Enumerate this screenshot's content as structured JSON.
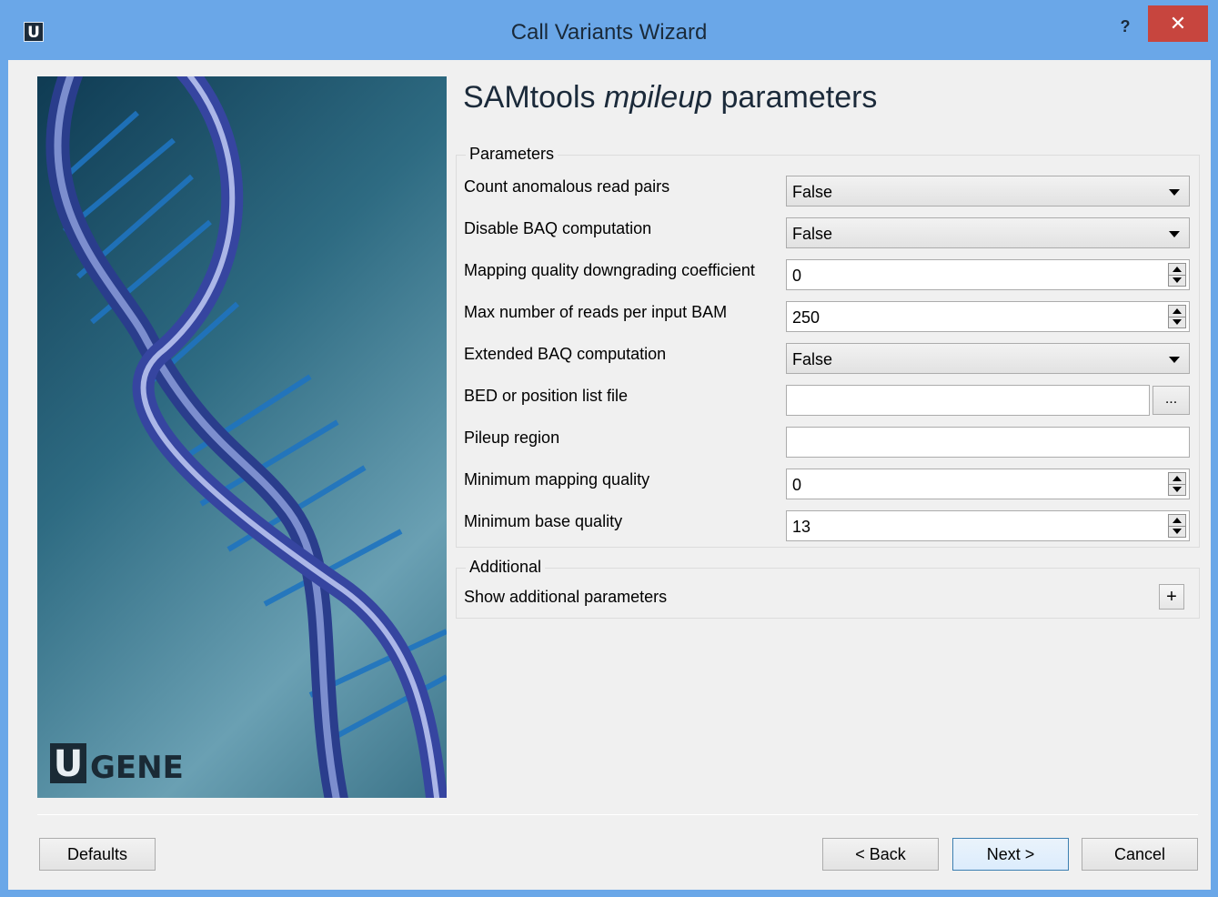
{
  "window": {
    "title": "Call Variants Wizard",
    "app_icon_letter": "U",
    "help_label": "?",
    "close_label": "✕"
  },
  "side_image": {
    "logo_letter": "U",
    "logo_text": "GENE"
  },
  "page": {
    "title_prefix": "SAMtools ",
    "title_italic": "mpileup",
    "title_suffix": " parameters"
  },
  "parameters": {
    "group_title": "Parameters",
    "count_anomalous": {
      "label": "Count anomalous read pairs",
      "value": "False"
    },
    "disable_baq": {
      "label": "Disable BAQ computation",
      "value": "False"
    },
    "mapping_coeff": {
      "label": "Mapping quality downgrading coefficient",
      "value": "0"
    },
    "max_reads": {
      "label": "Max number of reads per input BAM",
      "value": "250"
    },
    "extended_baq": {
      "label": "Extended BAQ computation",
      "value": "False"
    },
    "bed_file": {
      "label": "BED or position list file",
      "value": "",
      "browse_label": "..."
    },
    "pileup_region": {
      "label": "Pileup region",
      "value": ""
    },
    "min_mapping": {
      "label": "Minimum mapping quality",
      "value": "0"
    },
    "min_base": {
      "label": "Minimum base quality",
      "value": "13"
    }
  },
  "additional": {
    "group_title": "Additional",
    "show_label": "Show additional parameters",
    "expand_label": "+"
  },
  "buttons": {
    "defaults": "Defaults",
    "back": "< Back",
    "next": "Next >",
    "cancel": "Cancel"
  },
  "colors": {
    "titlebar": "#6aa7e8",
    "close": "#c7453e",
    "dialog_bg": "#f0f0f0"
  }
}
